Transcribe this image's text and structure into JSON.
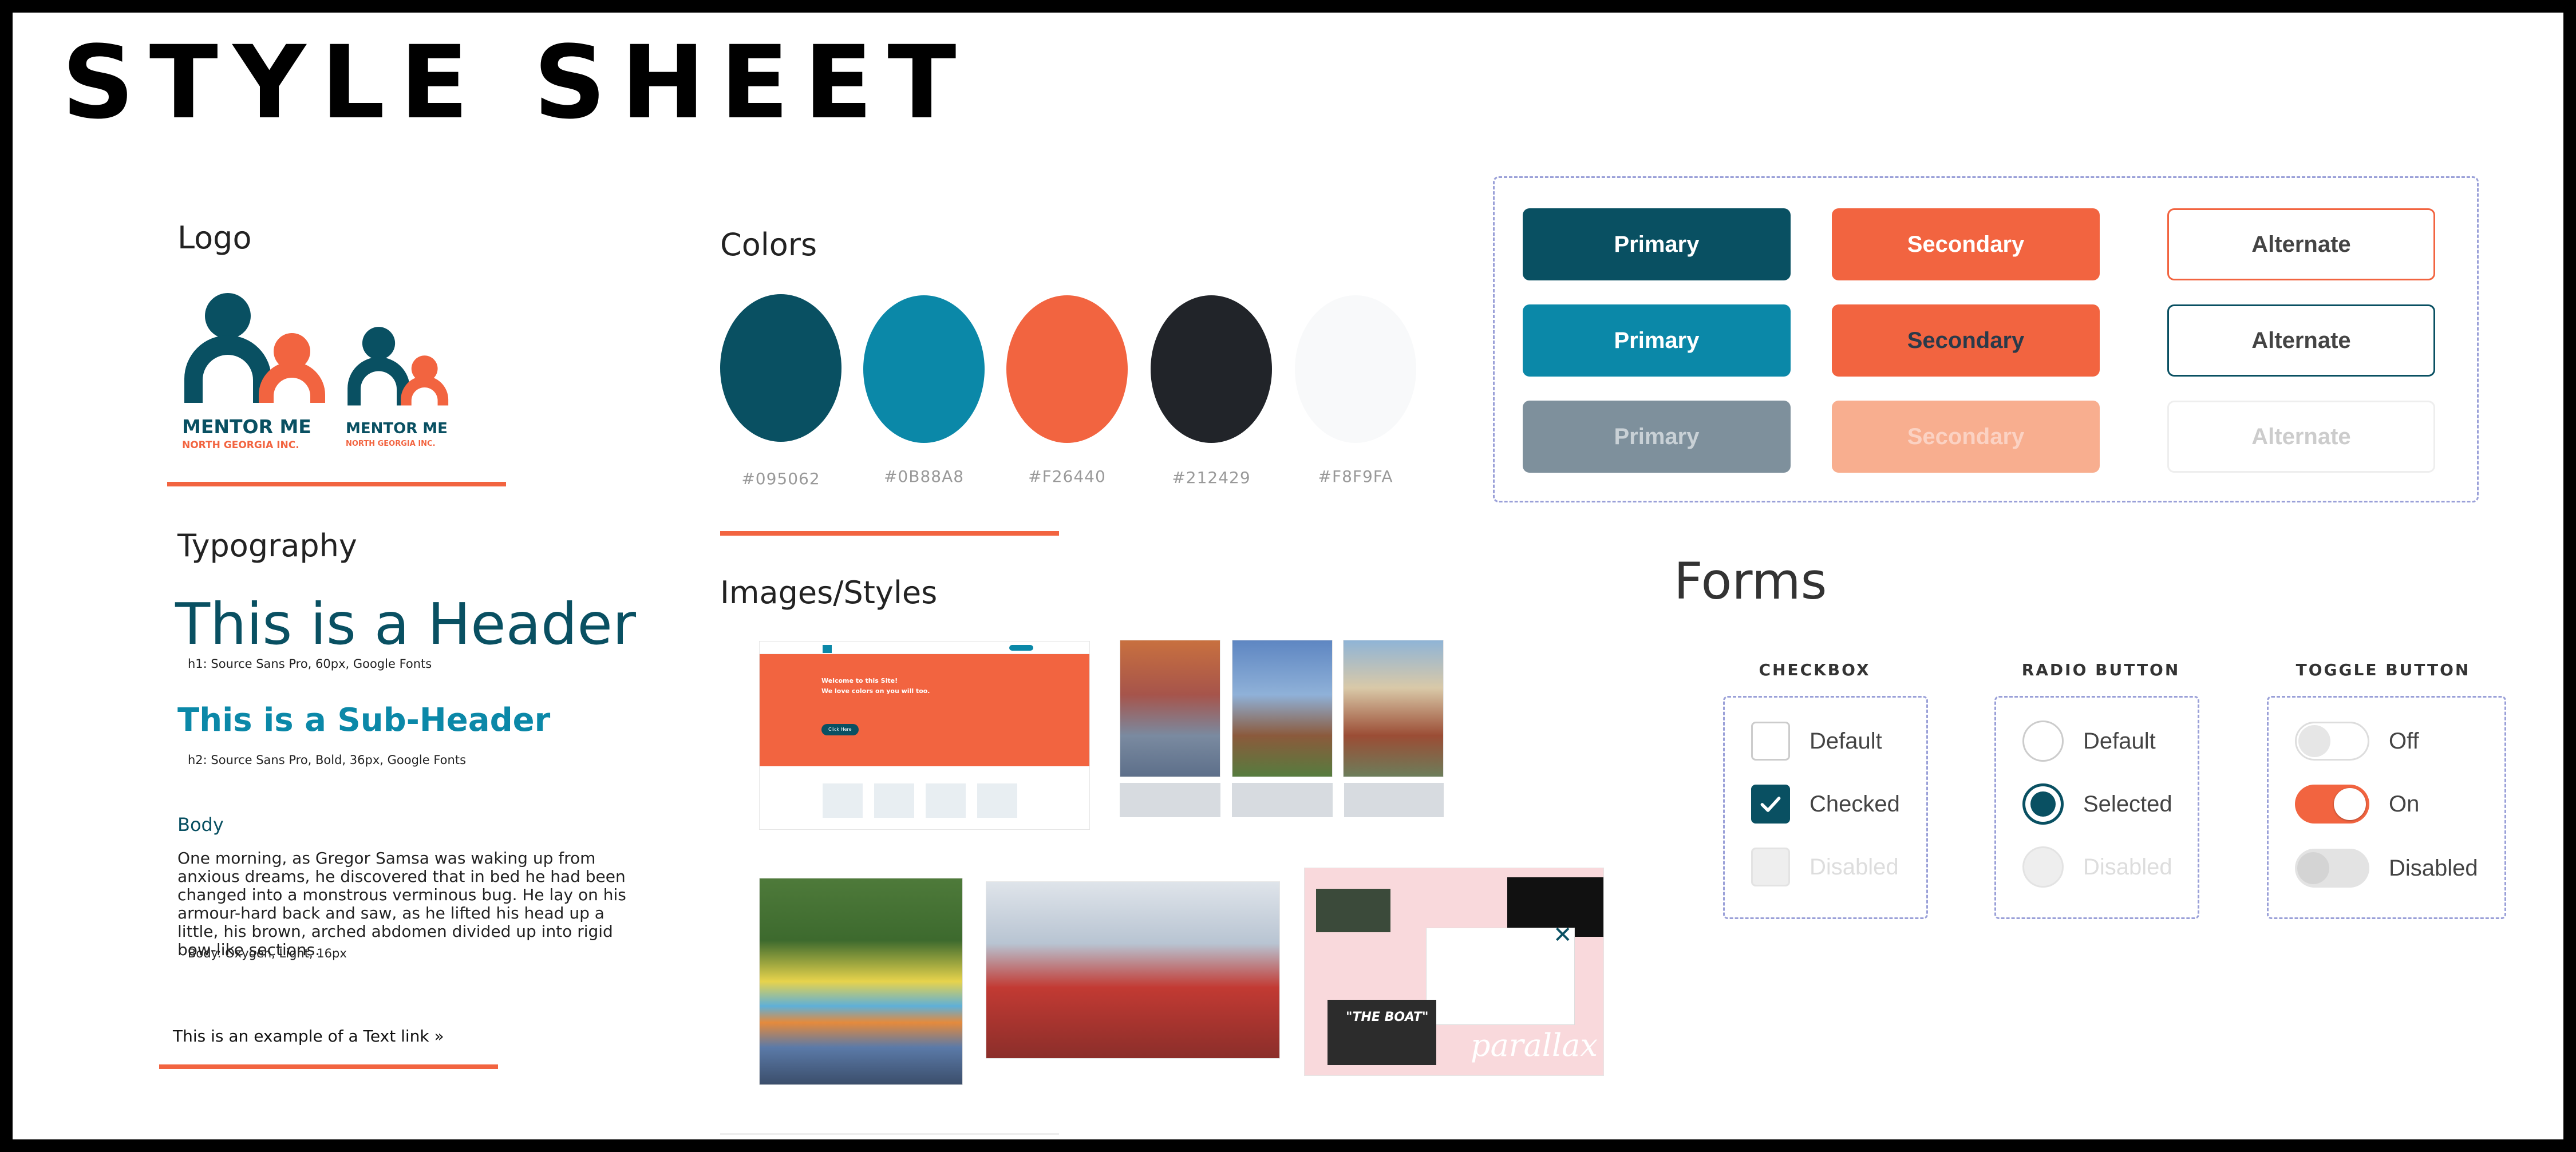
{
  "title": "STYLE SHEET",
  "logo": {
    "heading": "Logo",
    "name": "MENTOR ME",
    "tagline": "NORTH GEORGIA INC."
  },
  "typography": {
    "heading": "Typography",
    "h1_sample": "This is a Header",
    "h1_caption": "h1: Source Sans Pro, 60px, Google Fonts",
    "h2_sample": "This is a Sub-Header",
    "h2_caption": "h2: Source Sans Pro, Bold, 36px, Google Fonts",
    "body_label": "Body",
    "body_text": "One morning, as Gregor Samsa was waking up from anxious dreams, he discovered that in bed he had been changed into a monstrous verminous bug. He lay on his armour-hard back and saw, as he lifted his head up a little, his brown, arched abdomen divided up into rigid bow-like sections.",
    "body_caption": "Body: Oxygen, Light, 16px",
    "text_link": "This is an example of a Text link »"
  },
  "colors": {
    "heading": "Colors",
    "swatches": [
      {
        "hex": "#095062",
        "label": "#095062"
      },
      {
        "hex": "#0B88A8",
        "label": "#0B88A8"
      },
      {
        "hex": "#F26440",
        "label": "#F26440"
      },
      {
        "hex": "#212429",
        "label": "#212429"
      },
      {
        "hex": "#F8F9FA",
        "label": "#F8F9FA"
      }
    ]
  },
  "buttons": {
    "row1": {
      "primary": "Primary",
      "secondary": "Secondary",
      "alternate": "Alternate"
    },
    "row2": {
      "primary": "Primary",
      "secondary": "Secondary",
      "alternate": "Alternate"
    },
    "row3": {
      "primary": "Primary",
      "secondary": "Secondary",
      "alternate": "Alternate"
    }
  },
  "images": {
    "heading": "Images/Styles",
    "hero_title": "Welcome to this Site!",
    "hero_subtitle": "We love colors on you will too.",
    "hero_button": "Click Here",
    "parallax_word": "parallax",
    "boat_caption": "\"THE BOAT\""
  },
  "forms": {
    "heading": "Forms",
    "checkbox": {
      "heading": "CHECKBOX",
      "default": "Default",
      "checked": "Checked",
      "disabled": "Disabled"
    },
    "radio": {
      "heading": "RADIO BUTTON",
      "default": "Default",
      "selected": "Selected",
      "disabled": "Disabled"
    },
    "toggle": {
      "heading": "TOGGLE BUTTON",
      "off": "Off",
      "on": "On",
      "disabled": "Disabled"
    }
  },
  "palette": {
    "dark_teal": "#095062",
    "teal": "#0B88A8",
    "orange": "#F26440",
    "charcoal": "#212429",
    "off_white": "#F8F9FA",
    "disabled_grey": "#7E909C",
    "disabled_orange": "#F8AE8F"
  }
}
